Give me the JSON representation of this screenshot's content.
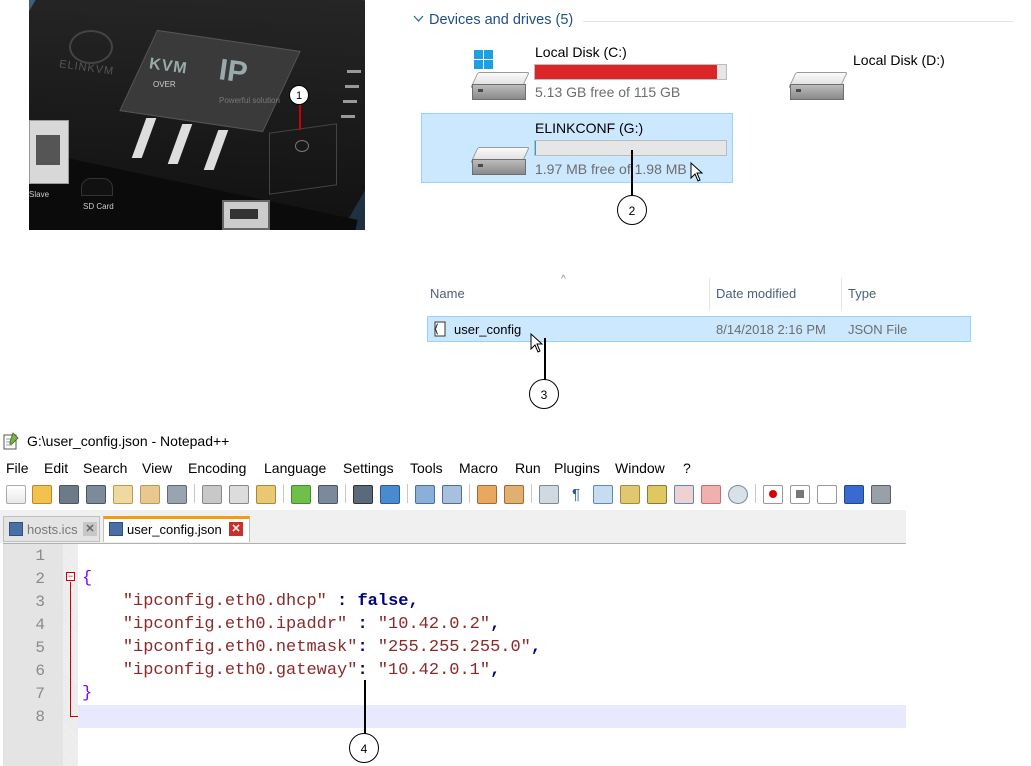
{
  "device": {
    "brand": "ELINKVM",
    "label_kvm": "KVM",
    "label_over": "OVER",
    "label_ip": "IP",
    "label_slogan": "Powerful solution",
    "port_label": "Slave",
    "sd_label": "SD Card"
  },
  "callouts": [
    "1",
    "2",
    "3",
    "4"
  ],
  "devices": {
    "title": "Devices and drives (5)",
    "chevron_icon": "chevron-down-icon",
    "drives": [
      {
        "name": "Local Disk (C:)",
        "free": "5.13 GB free of 115 GB",
        "used_fraction": 0.955,
        "bar_color": "#da2626",
        "icon": "windows-drive-icon"
      },
      {
        "name": "Local Disk (D:)",
        "free": "",
        "icon": "hard-drive-icon"
      },
      {
        "name": "ELINKCONF (G:)",
        "free": "1.97 MB free of 1.98 MB",
        "used_fraction": 0.005,
        "bar_color": "#26a0da",
        "icon": "hard-drive-icon"
      }
    ]
  },
  "file_list": {
    "columns": [
      "Name",
      "Date modified",
      "Type"
    ],
    "sort_indicator": "^",
    "rows": [
      {
        "name": "user_config",
        "date": "8/14/2018 2:16 PM",
        "type": "JSON File",
        "icon": "json-file-icon"
      }
    ]
  },
  "notepad": {
    "title": "G:\\user_config.json - Notepad++",
    "menu": [
      "File",
      "Edit",
      "Search",
      "View",
      "Encoding",
      "Language",
      "Settings",
      "Tools",
      "Macro",
      "Run",
      "Plugins",
      "Window",
      "?"
    ],
    "tabs": [
      {
        "label": "hosts.ics",
        "active": false
      },
      {
        "label": "user_config.json",
        "active": true
      }
    ],
    "close_glyph": "✕",
    "fold_glyph": "−",
    "line_numbers": [
      "1",
      "2",
      "3",
      "4",
      "5",
      "6",
      "7",
      "8"
    ],
    "code": {
      "open_brace": "{",
      "close_brace": "}",
      "lines": [
        {
          "key": "\"ipconfig.eth0.dhcp\"",
          "sep": " : ",
          "value": "false",
          "value_is_keyword": true,
          "trail": ","
        },
        {
          "key": "\"ipconfig.eth0.ipaddr\"",
          "sep": " : ",
          "value": "\"10.42.0.2\"",
          "value_is_keyword": false,
          "trail": ","
        },
        {
          "key": "\"ipconfig.eth0.netmask\"",
          "sep": ": ",
          "value": "\"255.255.255.0\"",
          "value_is_keyword": false,
          "trail": ","
        },
        {
          "key": "\"ipconfig.eth0.gateway\"",
          "sep": ": ",
          "value": "\"10.42.0.1\"",
          "value_is_keyword": false,
          "trail": ","
        }
      ]
    }
  }
}
